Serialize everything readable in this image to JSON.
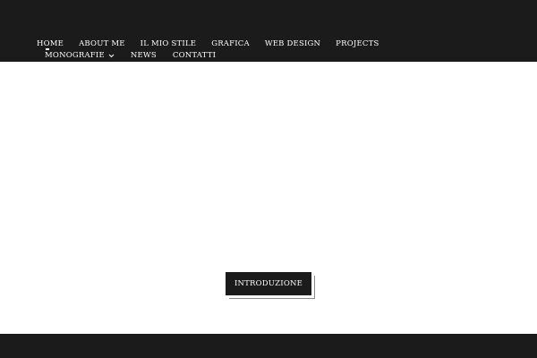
{
  "nav": {
    "primary": [
      {
        "label": "HOME",
        "active": true
      },
      {
        "label": "ABOUT ME"
      },
      {
        "label": "IL MIO STILE"
      },
      {
        "label": "GRAFICA"
      },
      {
        "label": "WEB DESIGN"
      },
      {
        "label": "PROJECTS"
      }
    ],
    "secondary": [
      {
        "label": "MONOGRAFIE",
        "has_dropdown": true,
        "icon": "chevron-down-icon"
      },
      {
        "label": "NEWS"
      },
      {
        "label": "CONTATTI"
      }
    ]
  },
  "hero": {
    "cta_label": "INTRODUZIONE"
  },
  "colors": {
    "header_bg": "#1b1b1b",
    "page_bg": "#ffffff",
    "text_light": "#ffffff"
  }
}
